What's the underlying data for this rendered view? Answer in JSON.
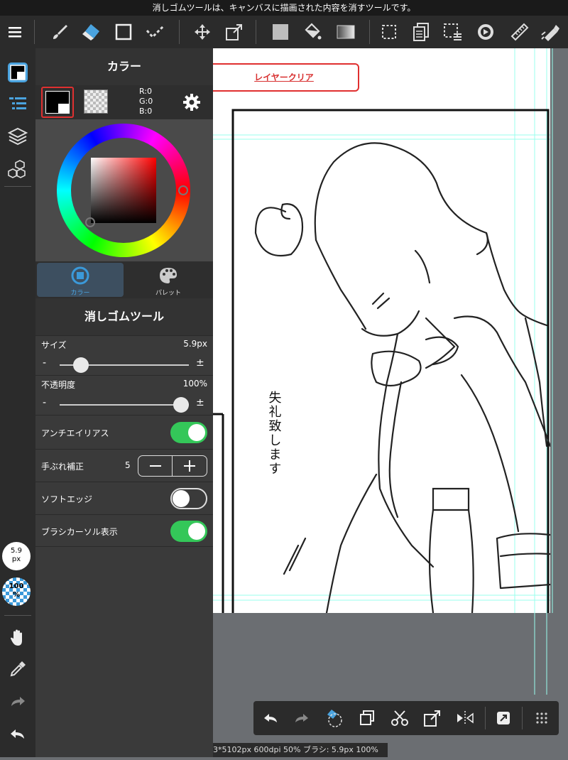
{
  "tip_text": "消しゴムツールは、キャンバスに描画された内容を消すツールです。",
  "toolbar": {
    "icons": [
      "menu-icon",
      "brush-icon",
      "eraser-icon",
      "square-icon",
      "selection-check-icon",
      "move-icon",
      "transform-icon",
      "fill-color-icon",
      "bucket-icon",
      "gradient-icon",
      "select-rect-icon",
      "copy-pages-icon",
      "select-layer-icon",
      "rotate-icon",
      "ruler-icon",
      "pen-edit-icon"
    ]
  },
  "canvas": {
    "layer_clear_label": "レイヤークリア",
    "dialogue_text": "失礼致します"
  },
  "color_panel": {
    "title": "カラー",
    "rgb": {
      "r": "R:0",
      "g": "G:0",
      "b": "B:0"
    },
    "tabs": [
      {
        "label": "カラー"
      },
      {
        "label": "パレット"
      }
    ]
  },
  "tool_panel": {
    "title": "消しゴムツール",
    "size": {
      "label": "サイズ",
      "value": "5.9px",
      "minus": "-",
      "plus": "±",
      "level": 0.12
    },
    "opacity": {
      "label": "不透明度",
      "value": "100%",
      "minus": "-",
      "plus": "±",
      "level": 1.0
    },
    "antialias": {
      "label": "アンチエイリアス",
      "on": true
    },
    "stabilizer": {
      "label": "手ぶれ補正",
      "value": "5"
    },
    "soft_edge": {
      "label": "ソフトエッジ",
      "on": false
    },
    "brush_cursor": {
      "label": "ブラシカーソル表示",
      "on": true
    }
  },
  "rail": {
    "size_badge": "5.9\npx",
    "opacity_badge": "100\n%"
  },
  "status": {
    "text": "3*5102px 600dpi 50% ブラシ: 5.9px 100%"
  },
  "colors": {
    "accent": "#3b99d9",
    "toggle_on": "#34c759",
    "highlight_red": "#e03030"
  }
}
